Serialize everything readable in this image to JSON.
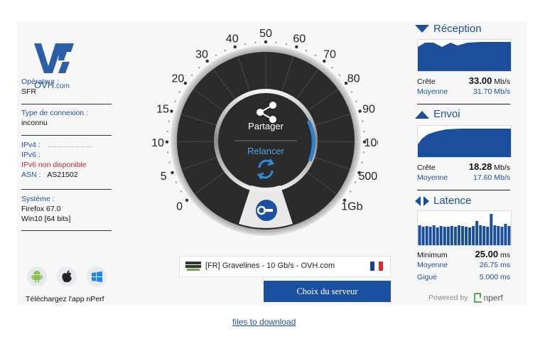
{
  "brand": {
    "name": "OVH",
    "suffix": ".com"
  },
  "operator": {
    "label": "Opérateur :",
    "value": "SFR"
  },
  "connection": {
    "label": "Type de connexion :",
    "value": "inconnu"
  },
  "ip": {
    "ipv4_label": "IPv4 :",
    "ipv6_label": "IPv6 :",
    "ipv6_value": "IPv6 non disponible",
    "asn_label": "ASN :",
    "asn_value": "AS21502"
  },
  "system": {
    "label": "Système :",
    "browser": "Firefox 67.0",
    "os": "Win10 [64 bits]"
  },
  "apps": {
    "text": "Téléchargez l'app nPerf"
  },
  "gauge": {
    "ticks": [
      "0",
      "5",
      "10",
      "15",
      "20",
      "30",
      "40",
      "50",
      "60",
      "70",
      "80",
      "90",
      "100",
      "500",
      "1Gb"
    ],
    "share_label": "Partager",
    "restart_label": "Relancer"
  },
  "server": {
    "name": "[FR] Gravelines - 10 Gb/s - OVH.com",
    "choose_label": "Choix du serveur"
  },
  "reception": {
    "title": "Réception",
    "peak_label": "Crête",
    "peak_value": "33.00",
    "unit": "Mb/s",
    "avg_label": "Moyenne",
    "avg_value": "31.70 Mb/s"
  },
  "upload": {
    "title": "Envoi",
    "peak_label": "Crête",
    "peak_value": "18.28",
    "unit": "Mb/s",
    "avg_label": "Moyenne",
    "avg_value": "17.60 Mb/s"
  },
  "latency": {
    "title": "Latence",
    "min_label": "Minimum",
    "min_value": "25.00",
    "unit": "ms",
    "avg_label": "Moyenne",
    "avg_value": "26.75 ms",
    "jitter_label": "Gigue",
    "jitter_value": "5.000 ms"
  },
  "powered": {
    "label": "Powered by",
    "brand": "nperf"
  },
  "footer": {
    "link": "files to download"
  },
  "colors": {
    "accent": "#1b4f9c",
    "error": "#c0272d",
    "button": "#1b4fa0"
  }
}
